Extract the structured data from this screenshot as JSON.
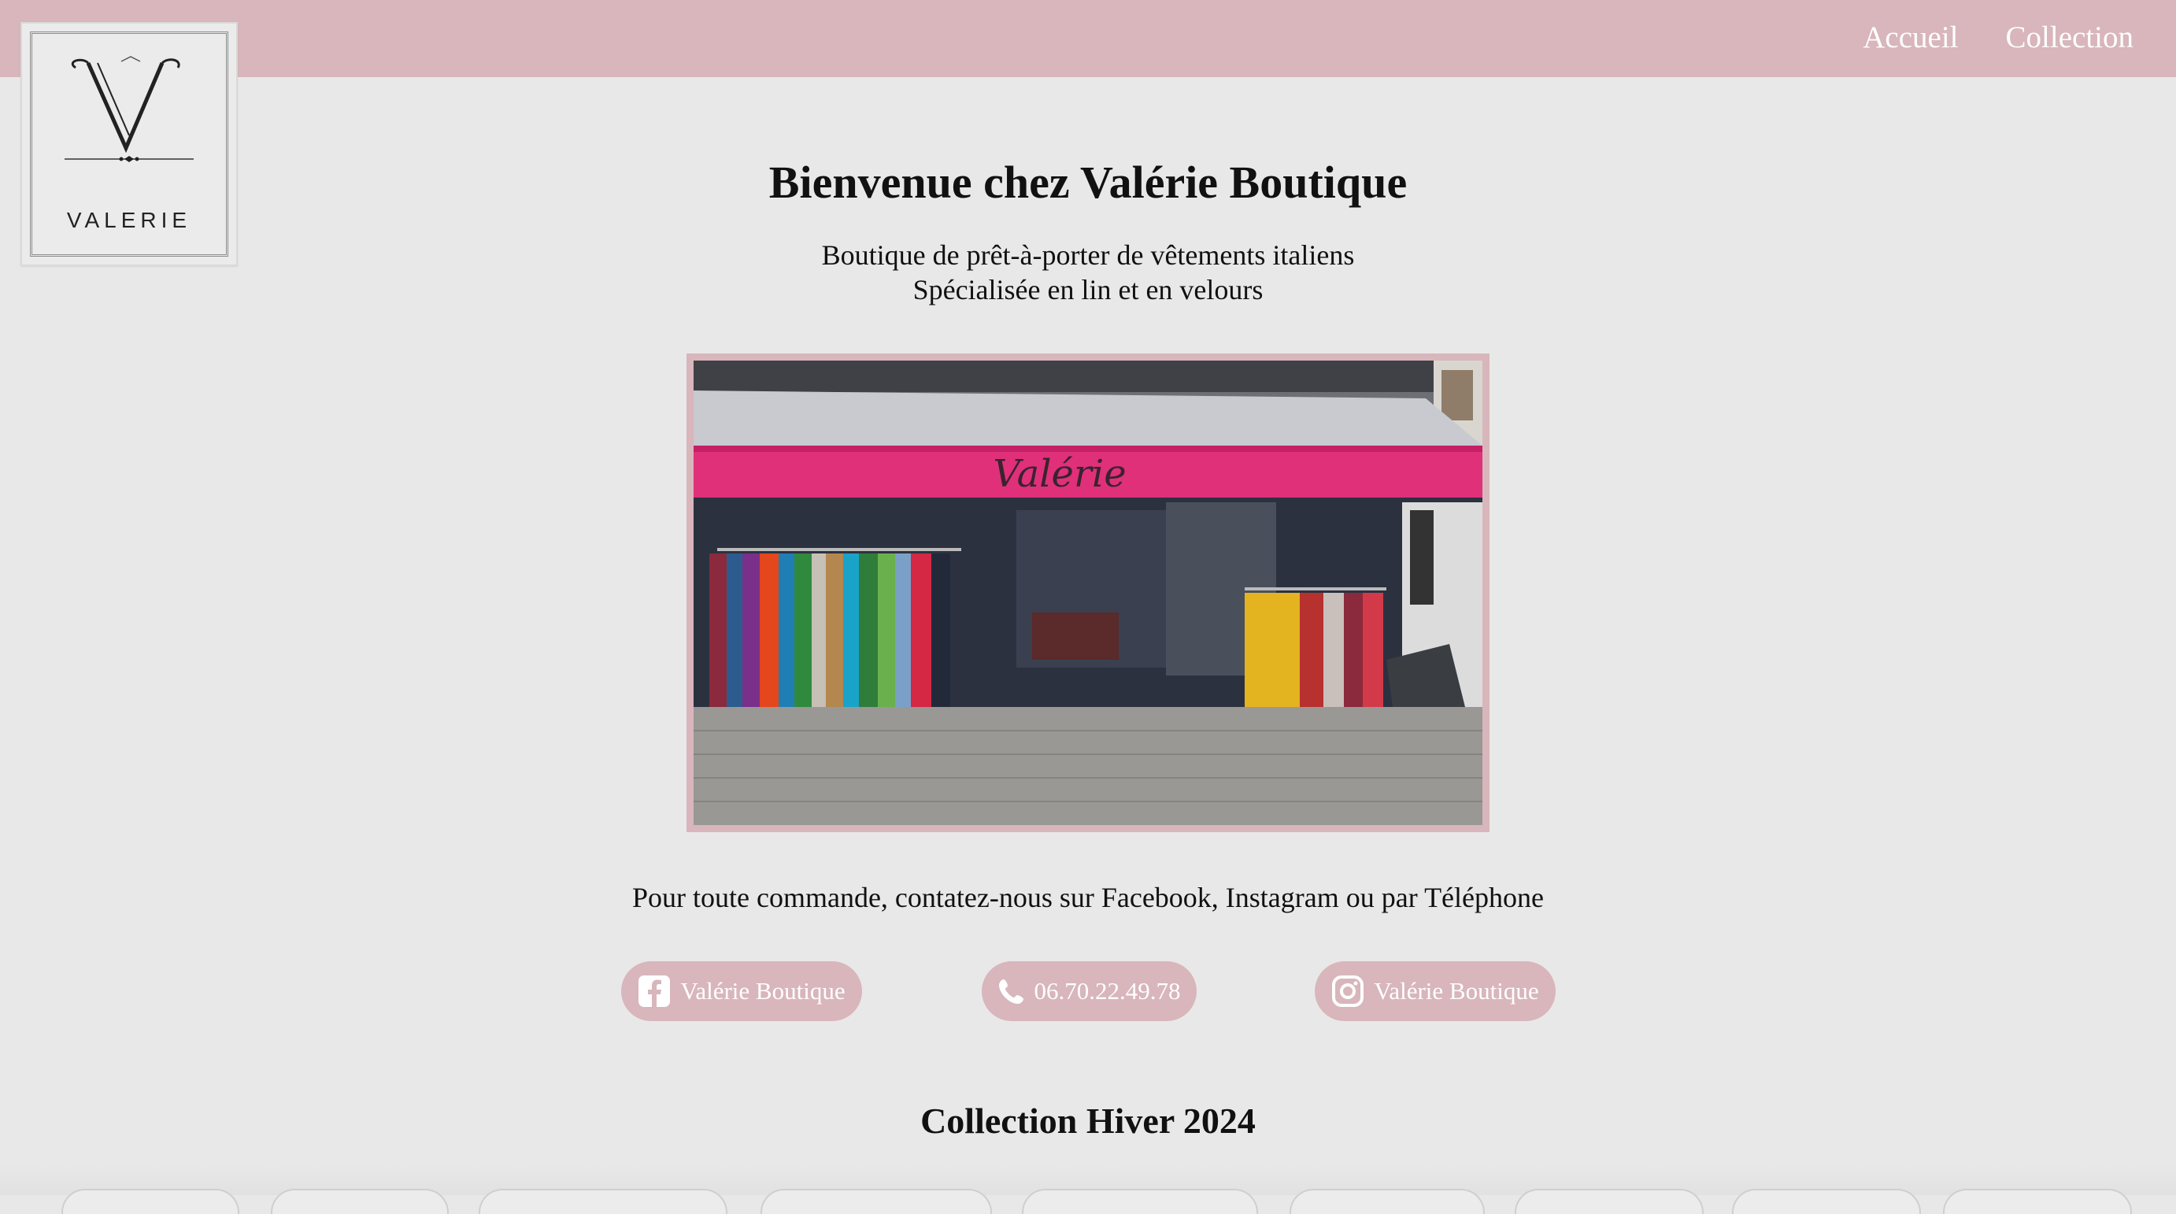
{
  "nav": {
    "items": [
      {
        "label": "Accueil"
      },
      {
        "label": "Collection"
      }
    ]
  },
  "logo": {
    "word": "VALERIE"
  },
  "hero": {
    "title": "Bienvenue chez Valérie Boutique",
    "subtitle_line1": "Boutique de prêt-à-porter de vêtements italiens",
    "subtitle_line2": "Spécialisée en lin et en velours"
  },
  "storefront": {
    "sign_text": "Valérie"
  },
  "contact": {
    "text": "Pour toute commande, contatez-nous sur Facebook, Instagram ou par Téléphone",
    "facebook_label": "Valérie Boutique",
    "phone_label": "06.70.22.49.78",
    "instagram_label": "Valérie Boutique"
  },
  "collection": {
    "title": "Collection Hiver 2024"
  },
  "colors": {
    "accent": "#d8b6bc",
    "background": "#e9e8e8",
    "awning_pink": "#e0307a"
  }
}
